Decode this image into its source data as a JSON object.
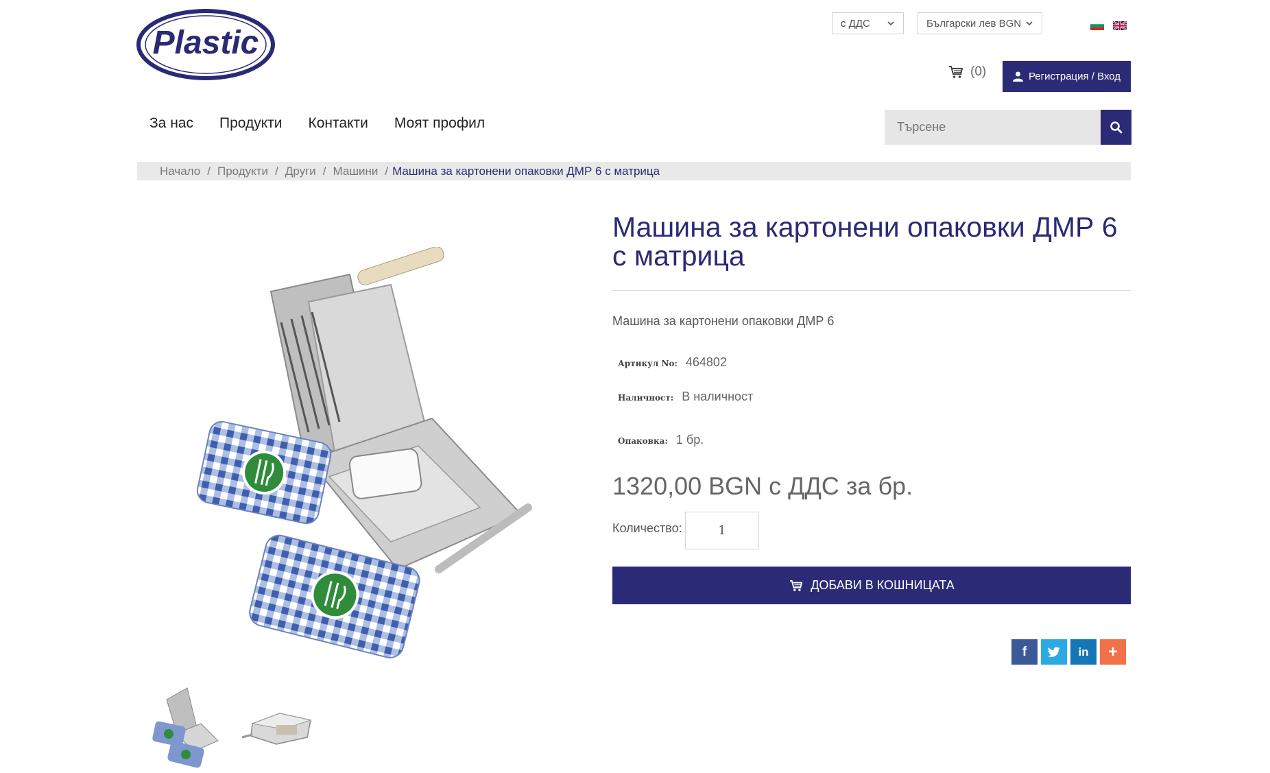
{
  "header": {
    "logo_text": "Plastic",
    "vat_select": "с ДДС",
    "currency_select": "Български лев BGN",
    "cart_count": "(0)",
    "login_label": "Регистрация / Вход"
  },
  "nav": {
    "items": [
      "За нас",
      "Продукти",
      "Контакти",
      "Моят профил"
    ]
  },
  "search": {
    "placeholder": "Търсене"
  },
  "breadcrumb": {
    "items": [
      "Начало",
      "Продукти",
      "Други",
      "Машини"
    ],
    "current": "Машина за картонени опаковки ДМР 6 с матрица"
  },
  "product": {
    "title": "Машина за картонени опаковки ДМР 6 с матрица",
    "short_description": "Машина за картонени опаковки ДМР 6",
    "sku_label": "Артикул No:",
    "sku": "464802",
    "stock_label": "Наличност:",
    "stock": "В наличност",
    "pack_label": "Опаковка:",
    "pack": "1 бр.",
    "price": "1320,00 BGN с ДДС за бр.",
    "qty_label": "Количество:",
    "qty_value": "1",
    "add_to_cart_label": "ДОБАВИ В КОШНИЦАТА"
  },
  "share": {
    "facebook": "f",
    "twitter": "t",
    "linkedin": "in",
    "more": "+"
  },
  "colors": {
    "brand": "#2a2a77",
    "facebook": "#3b5998",
    "twitter": "#2ca9e1",
    "linkedin": "#1577b5",
    "more": "#f0714a"
  }
}
